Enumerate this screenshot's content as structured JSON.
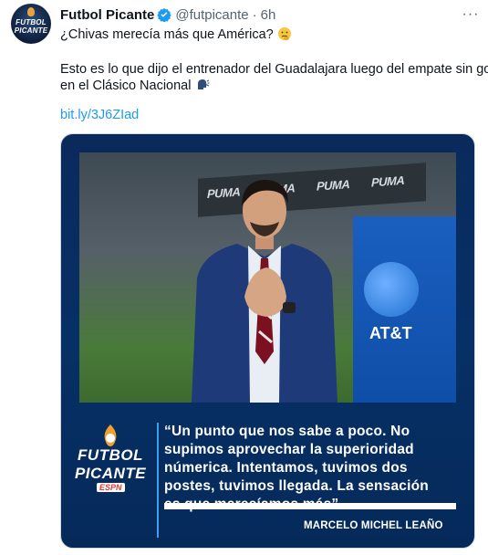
{
  "account": {
    "avatar_text_top": "FUTBOL",
    "avatar_text_bottom": "PICANTE",
    "display_name": "Futbol Picante",
    "handle": "@futpicante",
    "separator": "·",
    "time": "6h"
  },
  "more_label": "···",
  "tweet": {
    "line1": "¿Chivas merecía más que América?",
    "line2": "Esto es lo que dijo el entrenador del Guadalajara luego del empate sin goles",
    "line3": "en el Clásico Nacional",
    "link": "bit.ly/3J6ZIad"
  },
  "media": {
    "board_brand": "PUMA",
    "ad_text": "AT&T",
    "logo_line1": "FUTBOL",
    "logo_line2": "PICANTE",
    "logo_line3": "ESPN",
    "quote": "“Un punto que nos sabe a poco. No\nsupimos aprovechar la superioridad\nnúmerica. Intentamos, tuvimos dos\npostes, tuvimos llegada. La sensación\nes que merecíamos más”.",
    "speaker": "MARCELO MICHEL LEAÑO"
  },
  "colors": {
    "link": "#1d9bf0",
    "verified": "#1d9bf0",
    "media_bg": "#073066",
    "accent_bar": "#3da0e8"
  },
  "icons": [
    "verified-badge-icon",
    "more-icon",
    "thinking-face-emoji-icon",
    "speaking-head-emoji-icon"
  ]
}
